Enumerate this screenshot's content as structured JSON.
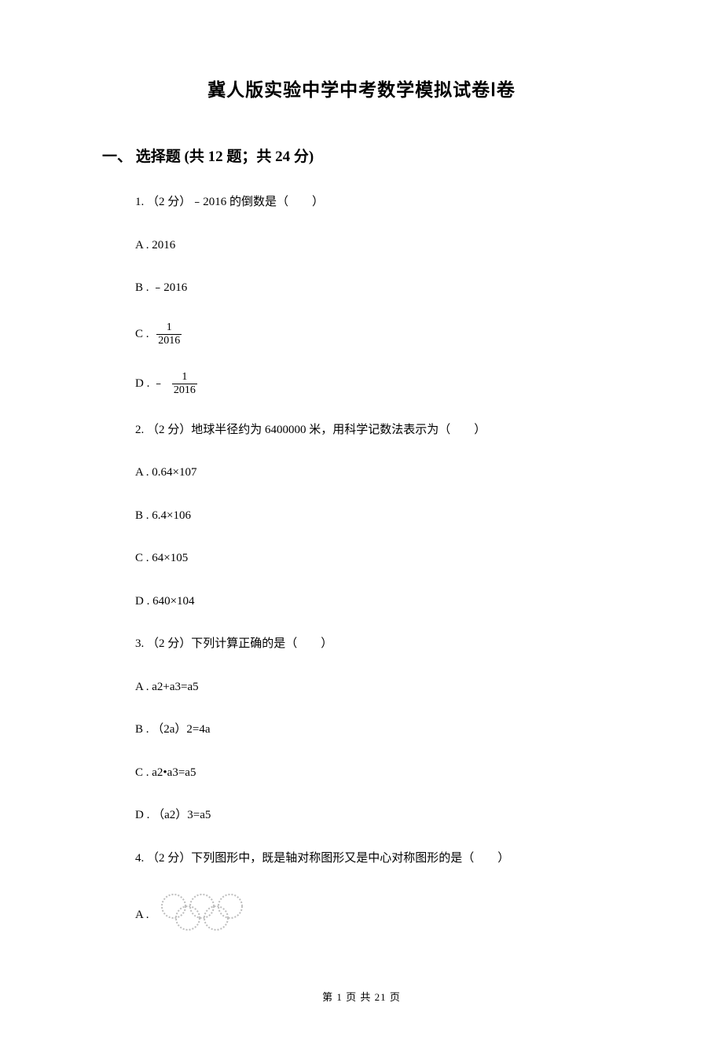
{
  "title": "冀人版实验中学中考数学模拟试卷Ⅰ卷",
  "section": {
    "label": "一、",
    "name": "选择题",
    "meta": "(共 12 题；共 24 分)"
  },
  "q1": {
    "stem": "1. （2 分）﹣2016 的倒数是（　　）",
    "a": "A . 2016",
    "b": "B . ﹣2016",
    "c_label": "C . ",
    "c_num": "1",
    "c_den": "2016",
    "d_label": "D . ﹣ ",
    "d_num": "1",
    "d_den": "2016"
  },
  "q2": {
    "stem": "2. （2 分）地球半径约为 6400000 米，用科学记数法表示为（　　）",
    "a": "A . 0.64×107",
    "b": "B . 6.4×106",
    "c": "C . 64×105",
    "d": "D . 640×104"
  },
  "q3": {
    "stem": "3. （2 分）下列计算正确的是（　　）",
    "a": "A . a2+a3=a5",
    "b": "B . （2a）2=4a",
    "c": "C . a2•a3=a5",
    "d": "D . （a2）3=a5"
  },
  "q4": {
    "stem": "4. （2 分）下列图形中，既是轴对称图形又是中心对称图形的是（　　）",
    "a_label": "A . "
  },
  "footer": {
    "page_current": "1",
    "page_total": "21",
    "prefix": "第 ",
    "mid": " 页 共 ",
    "suffix": " 页"
  }
}
